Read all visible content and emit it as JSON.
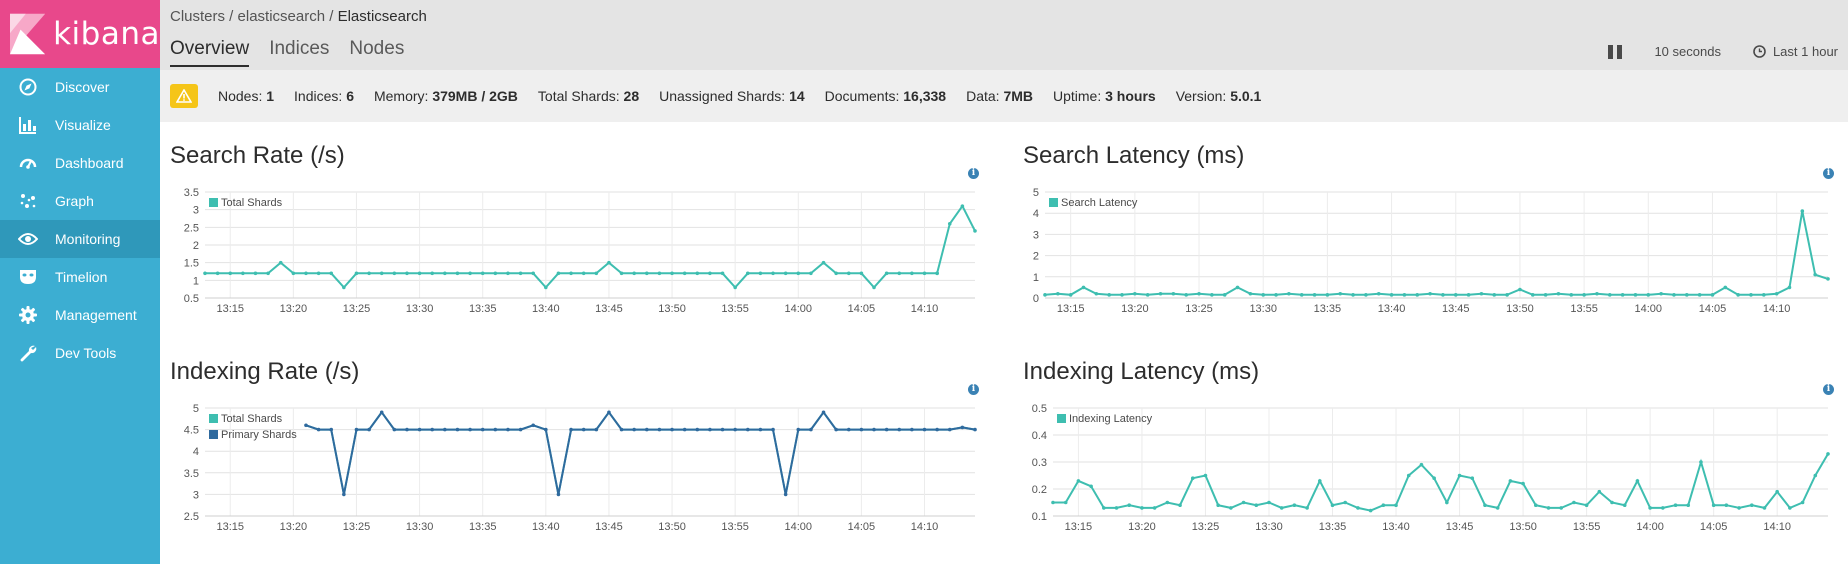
{
  "app": {
    "logo_text": "kibana"
  },
  "sidebar": {
    "items": [
      {
        "label": "Discover",
        "icon": "compass-icon",
        "active": false
      },
      {
        "label": "Visualize",
        "icon": "bar-chart-icon",
        "active": false
      },
      {
        "label": "Dashboard",
        "icon": "dashboard-icon",
        "active": false
      },
      {
        "label": "Graph",
        "icon": "graph-icon",
        "active": false
      },
      {
        "label": "Monitoring",
        "icon": "eye-icon",
        "active": true
      },
      {
        "label": "Timelion",
        "icon": "timelion-mask-icon",
        "active": false
      },
      {
        "label": "Management",
        "icon": "gear-icon",
        "active": false
      },
      {
        "label": "Dev Tools",
        "icon": "wrench-icon",
        "active": false
      }
    ]
  },
  "header": {
    "breadcrumb": {
      "part1": "Clusters",
      "sep": " / ",
      "part2": "elasticsearch",
      "current": "Elasticsearch"
    },
    "tabs": [
      {
        "label": "Overview",
        "active": true
      },
      {
        "label": "Indices",
        "active": false
      },
      {
        "label": "Nodes",
        "active": false
      }
    ],
    "refresh_interval": "10 seconds",
    "time_range": "Last 1 hour"
  },
  "summary": {
    "nodes_label": "Nodes:",
    "nodes_value": "1",
    "indices_label": "Indices:",
    "indices_value": "6",
    "memory_label": "Memory:",
    "memory_value": "379MB / 2GB",
    "total_shards_label": "Total Shards:",
    "total_shards_value": "28",
    "unassigned_label": "Unassigned Shards:",
    "unassigned_value": "14",
    "documents_label": "Documents:",
    "documents_value": "16,338",
    "data_label": "Data:",
    "data_value": "7MB",
    "uptime_label": "Uptime:",
    "uptime_value": "3 hours",
    "version_label": "Version:",
    "version_value": "5.0.1"
  },
  "colors": {
    "teal": "#3ebeb0",
    "navy": "#2f6a9e",
    "sidebar": "#3caed2",
    "logo_bg": "#e8488b",
    "warn": "#f5c518"
  },
  "chart_data": [
    {
      "id": "search-rate",
      "type": "line",
      "title": "Search Rate (/s)",
      "x_ticks": [
        "13:15",
        "13:20",
        "13:25",
        "13:30",
        "13:35",
        "13:40",
        "13:45",
        "13:50",
        "13:55",
        "14:00",
        "14:05",
        "14:10"
      ],
      "ylim": [
        0.5,
        3.5
      ],
      "y_ticks": [
        "0.5",
        "1",
        "1.5",
        "2",
        "2.5",
        "3",
        "3.5"
      ],
      "series": [
        {
          "name": "Total Shards",
          "color": "#3ebeb0",
          "markers": true,
          "x": [
            0,
            1,
            2,
            3,
            4,
            5,
            6,
            7,
            8,
            9,
            10,
            11,
            12,
            13,
            14,
            15,
            16,
            17,
            18,
            19,
            20,
            21,
            22,
            23,
            24,
            25,
            26,
            27,
            28,
            29,
            30,
            31,
            32,
            33,
            34,
            35,
            36,
            37,
            38,
            39,
            40,
            41,
            42,
            43,
            44,
            45,
            46,
            47,
            48,
            49,
            50,
            51,
            52,
            53,
            54,
            55,
            56,
            57,
            58
          ],
          "values": [
            1.2,
            1.2,
            1.2,
            1.2,
            1.2,
            1.2,
            1.5,
            1.2,
            1.2,
            1.2,
            1.2,
            0.8,
            1.2,
            1.2,
            1.2,
            1.2,
            1.2,
            1.2,
            1.2,
            1.2,
            1.2,
            1.2,
            1.2,
            1.2,
            1.2,
            1.2,
            1.2,
            0.8,
            1.2,
            1.2,
            1.2,
            1.2,
            1.5,
            1.2,
            1.2,
            1.2,
            1.2,
            1.2,
            1.2,
            1.2,
            1.2,
            1.2,
            0.8,
            1.2,
            1.2,
            1.2,
            1.2,
            1.2,
            1.2,
            1.5,
            1.2,
            1.2,
            1.2,
            0.8,
            1.2,
            1.2,
            1.2,
            1.2,
            1.2
          ]
        },
        {
          "name": "",
          "color": "#3ebeb0",
          "markers": true,
          "x": [
            58,
            59,
            60,
            61
          ],
          "values": [
            1.2,
            2.6,
            3.1,
            2.4
          ]
        }
      ]
    },
    {
      "id": "search-latency",
      "type": "line",
      "title": "Search Latency (ms)",
      "x_ticks": [
        "13:15",
        "13:20",
        "13:25",
        "13:30",
        "13:35",
        "13:40",
        "13:45",
        "13:50",
        "13:55",
        "14:00",
        "14:05",
        "14:10"
      ],
      "ylim": [
        0,
        5
      ],
      "y_ticks": [
        "0",
        "1",
        "2",
        "3",
        "4",
        "5"
      ],
      "series": [
        {
          "name": "Search Latency",
          "color": "#3ebeb0",
          "markers": true,
          "x": [
            0,
            1,
            2,
            3,
            4,
            5,
            6,
            7,
            8,
            9,
            10,
            11,
            12,
            13,
            14,
            15,
            16,
            17,
            18,
            19,
            20,
            21,
            22,
            23,
            24,
            25,
            26,
            27,
            28,
            29,
            30,
            31,
            32,
            33,
            34,
            35,
            36,
            37,
            38,
            39,
            40,
            41,
            42,
            43,
            44,
            45,
            46,
            47,
            48,
            49,
            50,
            51,
            52,
            53,
            54,
            55,
            56,
            57,
            58,
            59,
            60,
            61
          ],
          "values": [
            0.15,
            0.2,
            0.15,
            0.5,
            0.2,
            0.15,
            0.15,
            0.2,
            0.15,
            0.2,
            0.2,
            0.15,
            0.2,
            0.15,
            0.15,
            0.5,
            0.2,
            0.15,
            0.15,
            0.2,
            0.15,
            0.15,
            0.15,
            0.2,
            0.15,
            0.15,
            0.2,
            0.15,
            0.15,
            0.15,
            0.2,
            0.15,
            0.15,
            0.15,
            0.2,
            0.15,
            0.15,
            0.4,
            0.15,
            0.15,
            0.2,
            0.15,
            0.15,
            0.2,
            0.15,
            0.15,
            0.15,
            0.15,
            0.2,
            0.15,
            0.15,
            0.15,
            0.15,
            0.5,
            0.15,
            0.15,
            0.15,
            0.2,
            0.5,
            4.1,
            1.1,
            0.9
          ]
        }
      ]
    },
    {
      "id": "indexing-rate",
      "type": "line",
      "title": "Indexing Rate (/s)",
      "x_ticks": [
        "13:15",
        "13:20",
        "13:25",
        "13:30",
        "13:35",
        "13:40",
        "13:45",
        "13:50",
        "13:55",
        "14:00",
        "14:05",
        "14:10"
      ],
      "ylim": [
        2.5,
        5
      ],
      "y_ticks": [
        "2.5",
        "3",
        "3.5",
        "4",
        "4.5",
        "5"
      ],
      "series": [
        {
          "name": "Total Shards",
          "color": "#3ebeb0",
          "markers": false,
          "x": [
            8,
            9,
            10,
            11,
            12,
            13,
            14,
            15,
            16,
            17,
            18,
            19,
            20,
            21,
            22,
            23,
            24,
            25,
            26,
            27,
            28,
            29,
            30,
            31,
            32,
            33,
            34,
            35,
            36,
            37,
            38,
            39,
            40,
            41,
            42,
            43,
            44,
            45,
            46,
            47,
            48,
            49,
            50,
            51,
            52,
            53,
            54,
            55,
            56,
            57,
            58,
            59,
            60,
            61
          ],
          "values": [
            4.6,
            4.5,
            4.5,
            3.0,
            4.5,
            4.5,
            4.9,
            4.5,
            4.5,
            4.5,
            4.5,
            4.5,
            4.5,
            4.5,
            4.5,
            4.5,
            4.5,
            4.5,
            4.6,
            4.5,
            3.0,
            4.5,
            4.5,
            4.5,
            4.9,
            4.5,
            4.5,
            4.5,
            4.5,
            4.5,
            4.5,
            4.5,
            4.5,
            4.5,
            4.5,
            4.5,
            4.5,
            4.5,
            3.0,
            4.5,
            4.5,
            4.9,
            4.5,
            4.5,
            4.5,
            4.5,
            4.5,
            4.5,
            4.5,
            4.5,
            4.5,
            4.5,
            4.55,
            4.5
          ]
        },
        {
          "name": "Primary Shards",
          "color": "#2f6a9e",
          "markers": true,
          "x": [
            8,
            9,
            10,
            11,
            12,
            13,
            14,
            15,
            16,
            17,
            18,
            19,
            20,
            21,
            22,
            23,
            24,
            25,
            26,
            27,
            28,
            29,
            30,
            31,
            32,
            33,
            34,
            35,
            36,
            37,
            38,
            39,
            40,
            41,
            42,
            43,
            44,
            45,
            46,
            47,
            48,
            49,
            50,
            51,
            52,
            53,
            54,
            55,
            56,
            57,
            58,
            59,
            60,
            61
          ],
          "values": [
            4.6,
            4.5,
            4.5,
            3.0,
            4.5,
            4.5,
            4.9,
            4.5,
            4.5,
            4.5,
            4.5,
            4.5,
            4.5,
            4.5,
            4.5,
            4.5,
            4.5,
            4.5,
            4.6,
            4.5,
            3.0,
            4.5,
            4.5,
            4.5,
            4.9,
            4.5,
            4.5,
            4.5,
            4.5,
            4.5,
            4.5,
            4.5,
            4.5,
            4.5,
            4.5,
            4.5,
            4.5,
            4.5,
            3.0,
            4.5,
            4.5,
            4.9,
            4.5,
            4.5,
            4.5,
            4.5,
            4.5,
            4.5,
            4.5,
            4.5,
            4.5,
            4.5,
            4.55,
            4.5
          ]
        }
      ]
    },
    {
      "id": "indexing-latency",
      "type": "line",
      "title": "Indexing Latency (ms)",
      "x_ticks": [
        "13:15",
        "13:20",
        "13:25",
        "13:30",
        "13:35",
        "13:40",
        "13:45",
        "13:50",
        "13:55",
        "14:00",
        "14:05",
        "14:10"
      ],
      "ylim": [
        0.1,
        0.5
      ],
      "y_ticks": [
        "0.1",
        "0.2",
        "0.3",
        "0.4",
        "0.5"
      ],
      "series": [
        {
          "name": "Indexing Latency",
          "color": "#3ebeb0",
          "markers": true,
          "x": [
            0,
            1,
            2,
            3,
            4,
            5,
            6,
            7,
            8,
            9,
            10,
            11,
            12,
            13,
            14,
            15,
            16,
            17,
            18,
            19,
            20,
            21,
            22,
            23,
            24,
            25,
            26,
            27,
            28,
            29,
            30,
            31,
            32,
            33,
            34,
            35,
            36,
            37,
            38,
            39,
            40,
            41,
            42,
            43,
            44,
            45,
            46,
            47,
            48,
            49,
            50,
            51,
            52,
            53,
            54,
            55,
            56,
            57,
            58,
            59,
            60,
            61
          ],
          "values": [
            0.15,
            0.15,
            0.23,
            0.21,
            0.13,
            0.13,
            0.14,
            0.13,
            0.13,
            0.15,
            0.14,
            0.24,
            0.25,
            0.14,
            0.13,
            0.15,
            0.14,
            0.15,
            0.13,
            0.14,
            0.13,
            0.23,
            0.14,
            0.15,
            0.13,
            0.12,
            0.14,
            0.14,
            0.25,
            0.29,
            0.24,
            0.15,
            0.25,
            0.24,
            0.14,
            0.13,
            0.23,
            0.22,
            0.14,
            0.13,
            0.13,
            0.15,
            0.14,
            0.19,
            0.15,
            0.14,
            0.23,
            0.13,
            0.13,
            0.14,
            0.14,
            0.3,
            0.14,
            0.14,
            0.13,
            0.14,
            0.13,
            0.19,
            0.13,
            0.15,
            0.25,
            0.33
          ]
        }
      ]
    }
  ]
}
